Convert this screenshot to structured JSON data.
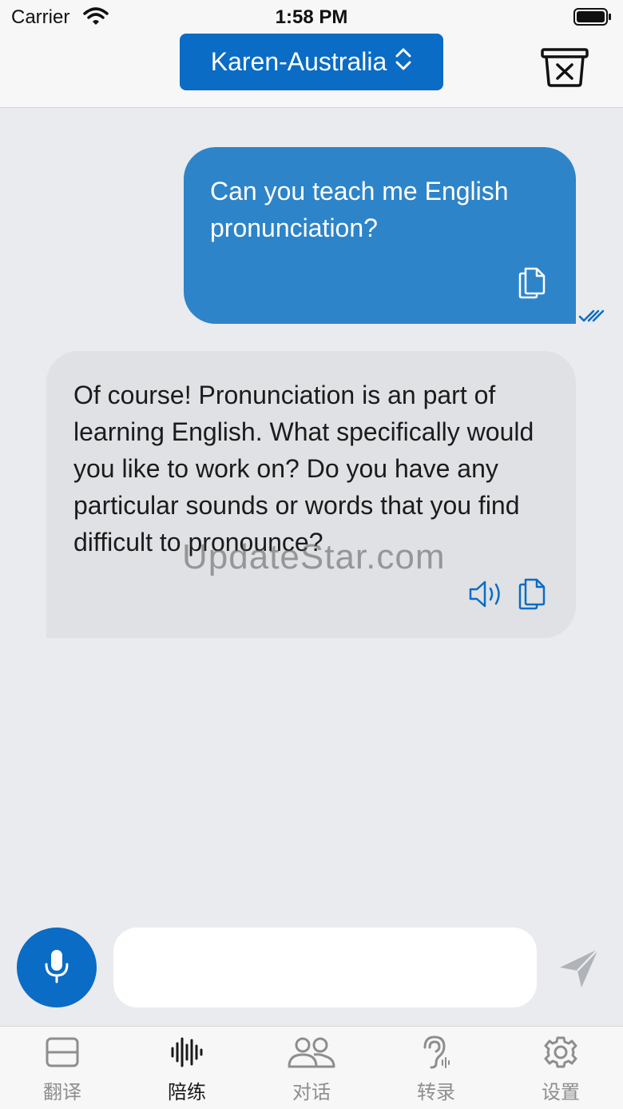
{
  "status_bar": {
    "carrier": "Carrier",
    "time": "1:58 PM"
  },
  "header": {
    "voice_label": "Karen-Australia",
    "voice_icon": "chevron-up-down-icon",
    "clear_icon": "trash-x-icon"
  },
  "messages": [
    {
      "role": "user",
      "text": "Can you teach me English pronunciation?",
      "status": "read"
    },
    {
      "role": "assistant",
      "text": "Of course! Pronunciation is an part of learning English. What specifically would you like to work on? Do you have any particular sounds or words that you find difficult to pronounce?"
    }
  ],
  "watermark": "UpdateStar.com",
  "composer": {
    "value": "",
    "placeholder": ""
  },
  "tabs": [
    {
      "label": "翻译",
      "icon": "translate-square-icon",
      "active": false
    },
    {
      "label": "陪练",
      "icon": "waveform-icon",
      "active": true
    },
    {
      "label": "对话",
      "icon": "people-icon",
      "active": false
    },
    {
      "label": "转录",
      "icon": "ear-icon",
      "active": false
    },
    {
      "label": "设置",
      "icon": "gear-icon",
      "active": false
    }
  ],
  "colors": {
    "accent": "#0a6cc4",
    "user_bubble": "#2e84c8",
    "bot_bubble": "#e0e1e4",
    "background": "#e9ebee"
  }
}
